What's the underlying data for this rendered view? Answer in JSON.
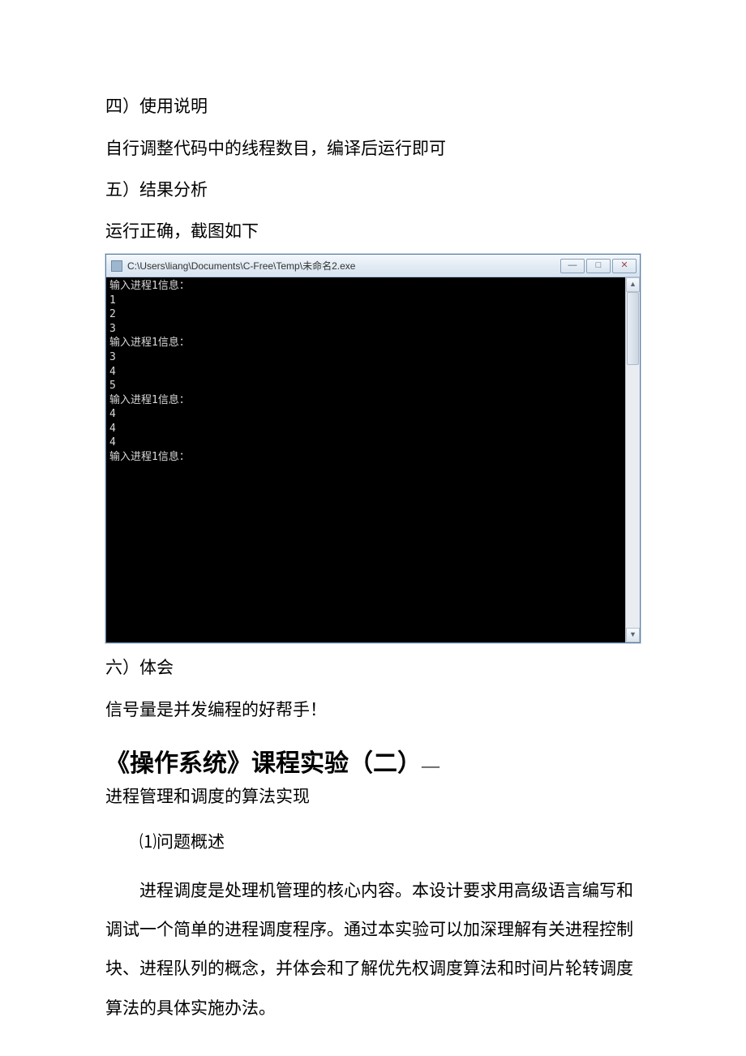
{
  "sections": {
    "s4_heading": "四）使用说明",
    "s4_body": "自行调整代码中的线程数目，编译后运行即可",
    "s5_heading": "五）结果分析",
    "s5_body": "运行正确，截图如下",
    "s6_heading": "六）体会",
    "s6_body": "信号量是并发编程的好帮手！"
  },
  "console": {
    "title": "C:\\Users\\liang\\Documents\\C-Free\\Temp\\未命名2.exe",
    "lines": "输入进程1信息：\n1\n2\n3\n输入进程1信息：\n3\n4\n5\n输入进程1信息：\n4\n4\n4\n输入进程1信息：",
    "btn_min": "—",
    "btn_max": "□",
    "btn_close": "✕",
    "scroll_up": "▲",
    "scroll_down": "▼"
  },
  "exp2": {
    "title_main": "《操作系统》课程实验（二）",
    "title_dash": "—",
    "subtitle": "进程管理和调度的算法实现",
    "q1_label": "⑴问题概述",
    "q1_body": "进程调度是处理机管理的核心内容。本设计要求用高级语言编写和调试一个简单的进程调度程序。通过本实验可以加深理解有关进程控制块、进程队列的概念，并体会和了解优先权调度算法和时间片轮转调度算法的具体实施办法。"
  }
}
